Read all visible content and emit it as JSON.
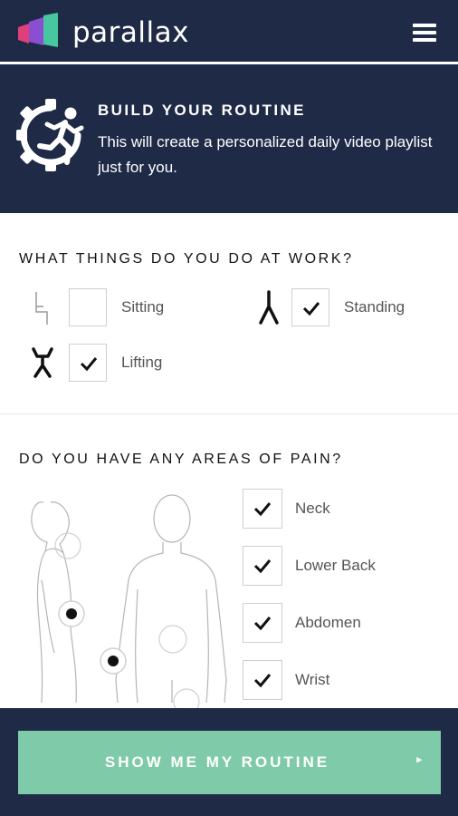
{
  "app": {
    "brand": "parallax",
    "menu_icon": "hamburger-menu-icon"
  },
  "header": {
    "title": "BUILD YOUR ROUTINE",
    "description": "This will create a personalized daily video playlist just for you.",
    "icon": "gear-running-person-icon"
  },
  "work": {
    "question": "WHAT THINGS DO YOU DO AT WORK?",
    "options": [
      {
        "label": "Sitting",
        "checked": false,
        "icon": "sitting-icon"
      },
      {
        "label": "Standing",
        "checked": true,
        "icon": "standing-icon"
      },
      {
        "label": "Lifting",
        "checked": true,
        "icon": "lifting-icon"
      }
    ]
  },
  "pain": {
    "question": "DO YOU HAVE ANY AREAS OF PAIN?",
    "areas": [
      {
        "label": "Neck",
        "checked": true
      },
      {
        "label": "Lower Back",
        "checked": true
      },
      {
        "label": "Abdomen",
        "checked": true
      },
      {
        "label": "Wrist",
        "checked": true
      }
    ]
  },
  "cta": {
    "label": "SHOW ME MY ROUTINE",
    "arrow": "▸"
  },
  "colors": {
    "navy": "#1f2a47",
    "accent_green": "#7fcaa8"
  }
}
